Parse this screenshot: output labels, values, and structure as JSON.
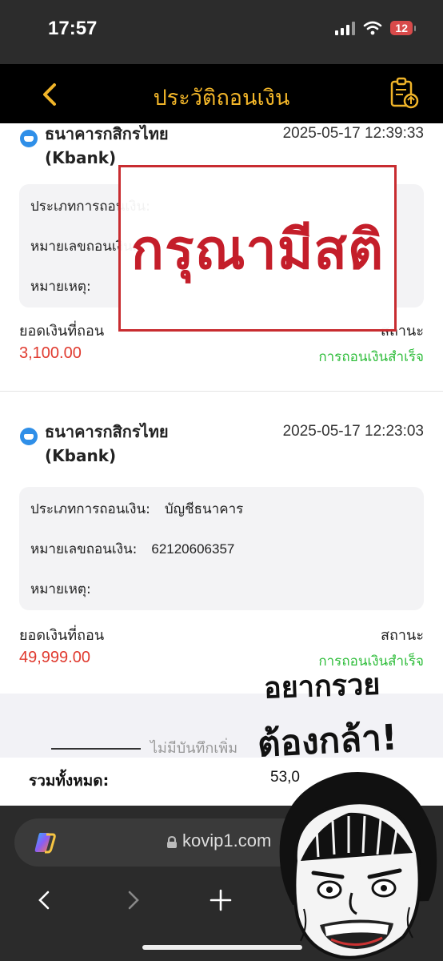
{
  "status_bar": {
    "time": "17:57",
    "battery": "12"
  },
  "header": {
    "title": "ประวัติถอนเงิน"
  },
  "records": [
    {
      "bank_name": "ธนาคารกสิกรไทย",
      "bank_code": "(Kbank)",
      "datetime": "2025-05-17 12:39:33",
      "type_label": "ประเภทการถอนเงิน:",
      "type_value": "",
      "number_label": "หมายเลขถอนเงิน:",
      "number_value": "",
      "note_label": "หมายเหตุ:",
      "amount_label": "ยอดเงินที่ถอน",
      "amount": "3,100.00",
      "status_label": "สถานะ",
      "status": "การถอนเงินสำเร็จ"
    },
    {
      "bank_name": "ธนาคารกสิกรไทย",
      "bank_code": "(Kbank)",
      "datetime": "2025-05-17 12:23:03",
      "type_label": "ประเภทการถอนเงิน:",
      "type_value": "บัญชีธนาคาร",
      "number_label": "หมายเลขถอนเงิน:",
      "number_value": "62120606357",
      "note_label": "หมายเหตุ:",
      "amount_label": "ยอดเงินที่ถอน",
      "amount": "49,999.00",
      "status_label": "สถานะ",
      "status": "การถอนเงินสำเร็จ"
    }
  ],
  "footer": {
    "no_more": "ไม่มีบันทึกเพิ่ม",
    "total_label": "รวมทั้งหมด:",
    "total_value": "53,0"
  },
  "stamp": {
    "text": "กรุณามีสติ"
  },
  "meme": {
    "line1": "อยากรวย",
    "line2": "ต้องกล้า!"
  },
  "browser": {
    "url": "kovip1.com"
  },
  "colors": {
    "accent": "#f0b429",
    "amount": "#e03a2f",
    "success": "#2ebd3a",
    "stamp": "#c41e2a"
  }
}
